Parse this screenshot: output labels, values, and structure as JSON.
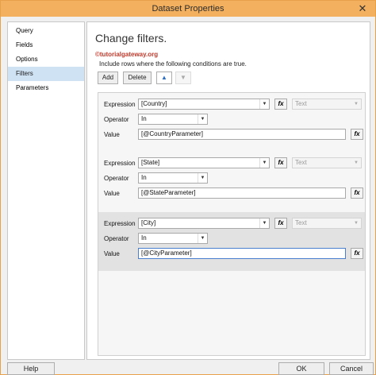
{
  "window": {
    "title": "Dataset Properties",
    "close_glyph": "✕"
  },
  "sidebar": {
    "items": [
      {
        "label": "Query"
      },
      {
        "label": "Fields"
      },
      {
        "label": "Options"
      },
      {
        "label": "Filters",
        "active": true
      },
      {
        "label": "Parameters"
      }
    ]
  },
  "main": {
    "heading": "Change filters.",
    "watermark": "©tutorialgateway.org",
    "subtitle": "Include rows where the following conditions are true.",
    "toolbar": {
      "add_label": "Add",
      "delete_label": "Delete",
      "up_icon": "▲",
      "down_icon": "▼"
    }
  },
  "labels": {
    "expression": "Expression",
    "operator": "Operator",
    "value": "Value",
    "fx": "fx"
  },
  "filters": [
    {
      "expression": "[Country]",
      "type": "Text",
      "operator": "In",
      "value": "[@CountryParameter]"
    },
    {
      "expression": "[State]",
      "type": "Text",
      "operator": "In",
      "value": "[@StateParameter]"
    },
    {
      "expression": "[City]",
      "type": "Text",
      "operator": "In",
      "value": "[@CityParameter]",
      "selected": true
    }
  ],
  "footer": {
    "help_label": "Help",
    "ok_label": "OK",
    "cancel_label": "Cancel"
  },
  "colors": {
    "title_bar": "#f3b05e",
    "selected_nav": "#cfe2f3",
    "selected_filter": "#e2e2e2"
  }
}
